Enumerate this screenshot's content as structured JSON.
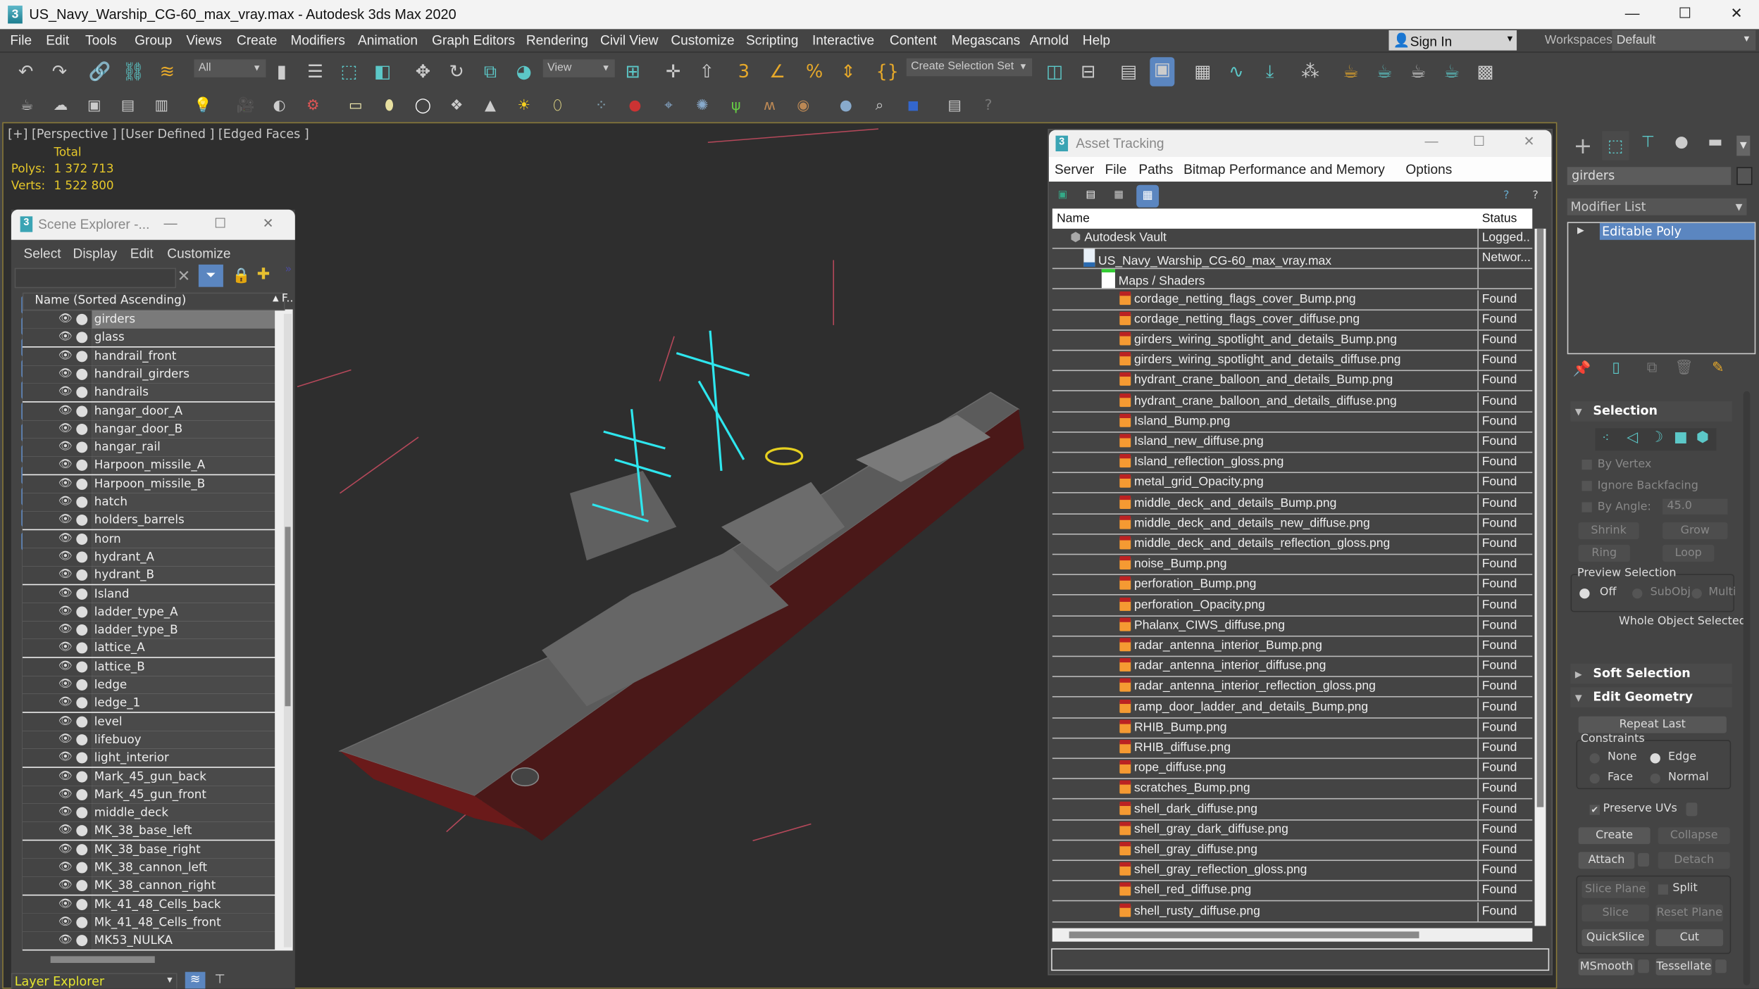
{
  "window": {
    "title": "US_Navy_Warship_CG-60_max_vray.max - Autodesk 3ds Max 2020",
    "app_icon": "3ds-max-logo"
  },
  "menu": [
    "File",
    "Edit",
    "Tools",
    "Group",
    "Views",
    "Create",
    "Modifiers",
    "Animation",
    "Graph Editors",
    "Rendering",
    "Civil View",
    "Customize",
    "Scripting",
    "Interactive",
    "Content",
    "Megascans",
    "Arnold",
    "Help"
  ],
  "account": {
    "sign_in": "Sign In",
    "workspaces_label": "Workspaces:",
    "workspace": "Default"
  },
  "toolbar": {
    "selection_filter": "All",
    "ref_coord": "View",
    "selection_set_placeholder": "Create Selection Set"
  },
  "viewport": {
    "label": "[+] [Perspective ] [User Defined ] [Edged Faces ]",
    "stats_header": "Total",
    "polys_label": "Polys:",
    "polys": "1 372 713",
    "verts_label": "Verts:",
    "verts": "1 522 800",
    "colors": {
      "grid_red": "#b5485a",
      "selection": "#2ee6ee",
      "hull": "#6a6a6a",
      "keel": "#8a1a1a"
    }
  },
  "scene_explorer": {
    "title": "Scene Explorer -...",
    "menu": [
      "Select",
      "Display",
      "Edit",
      "Customize"
    ],
    "column_header": "Name (Sorted Ascending)",
    "column2": "F..",
    "items": [
      "girders",
      "glass",
      "handrail_front",
      "handrail_girders",
      "handrails",
      "hangar_door_A",
      "hangar_door_B",
      "hangar_rail",
      "Harpoon_missile_A",
      "Harpoon_missile_B",
      "hatch",
      "holders_barrels",
      "horn",
      "hydrant_A",
      "hydrant_B",
      "Island",
      "ladder_type_A",
      "ladder_type_B",
      "lattice_A",
      "lattice_B",
      "ledge",
      "ledge_1",
      "level",
      "lifebuoy",
      "light_interior",
      "Mark_45_gun_back",
      "Mark_45_gun_front",
      "middle_deck",
      "MK_38_base_left",
      "MK_38_base_right",
      "MK_38_cannon_left",
      "MK_38_cannon_right",
      "Mk_41_48_Cells_back",
      "Mk_41_48_Cells_front",
      "MK53_NULKA"
    ],
    "selected": "girders",
    "footer_dropdown": "Layer Explorer"
  },
  "asset_tracking": {
    "title": "Asset Tracking",
    "menu": [
      "Server",
      "File",
      "Paths",
      "Bitmap Performance and Memory",
      "Options"
    ],
    "columns": [
      "Name",
      "Status"
    ],
    "rows": [
      {
        "name": "Autodesk Vault",
        "status": "Logged..",
        "level": 0,
        "icon": "vault-icon"
      },
      {
        "name": "US_Navy_Warship_CG-60_max_vray.max",
        "status": "Networ...",
        "level": 1,
        "icon": "max-file-icon"
      },
      {
        "name": "Maps / Shaders",
        "status": "",
        "level": 2,
        "icon": "maps-folder-icon"
      },
      {
        "name": "cordage_netting_flags_cover_Bump.png",
        "status": "Found",
        "level": 3,
        "icon": "png-icon"
      },
      {
        "name": "cordage_netting_flags_cover_diffuse.png",
        "status": "Found",
        "level": 3,
        "icon": "png-icon"
      },
      {
        "name": "girders_wiring_spotlight_and_details_Bump.png",
        "status": "Found",
        "level": 3,
        "icon": "png-icon"
      },
      {
        "name": "girders_wiring_spotlight_and_details_diffuse.png",
        "status": "Found",
        "level": 3,
        "icon": "png-icon"
      },
      {
        "name": "hydrant_crane_balloon_and_details_Bump.png",
        "status": "Found",
        "level": 3,
        "icon": "png-icon"
      },
      {
        "name": "hydrant_crane_balloon_and_details_diffuse.png",
        "status": "Found",
        "level": 3,
        "icon": "png-icon"
      },
      {
        "name": "Island_Bump.png",
        "status": "Found",
        "level": 3,
        "icon": "png-icon"
      },
      {
        "name": "Island_new_diffuse.png",
        "status": "Found",
        "level": 3,
        "icon": "png-icon"
      },
      {
        "name": "Island_reflection_gloss.png",
        "status": "Found",
        "level": 3,
        "icon": "png-icon"
      },
      {
        "name": "metal_grid_Opacity.png",
        "status": "Found",
        "level": 3,
        "icon": "png-icon"
      },
      {
        "name": "middle_deck_and_details_Bump.png",
        "status": "Found",
        "level": 3,
        "icon": "png-icon"
      },
      {
        "name": "middle_deck_and_details_new_diffuse.png",
        "status": "Found",
        "level": 3,
        "icon": "png-icon"
      },
      {
        "name": "middle_deck_and_details_reflection_gloss.png",
        "status": "Found",
        "level": 3,
        "icon": "png-icon"
      },
      {
        "name": "noise_Bump.png",
        "status": "Found",
        "level": 3,
        "icon": "png-icon"
      },
      {
        "name": "perforation_Bump.png",
        "status": "Found",
        "level": 3,
        "icon": "png-icon"
      },
      {
        "name": "perforation_Opacity.png",
        "status": "Found",
        "level": 3,
        "icon": "png-icon"
      },
      {
        "name": "Phalanx_CIWS_diffuse.png",
        "status": "Found",
        "level": 3,
        "icon": "png-icon"
      },
      {
        "name": "radar_antenna_interior_Bump.png",
        "status": "Found",
        "level": 3,
        "icon": "png-icon"
      },
      {
        "name": "radar_antenna_interior_diffuse.png",
        "status": "Found",
        "level": 3,
        "icon": "png-icon"
      },
      {
        "name": "radar_antenna_interior_reflection_gloss.png",
        "status": "Found",
        "level": 3,
        "icon": "png-icon"
      },
      {
        "name": "ramp_door_ladder_and_details_Bump.png",
        "status": "Found",
        "level": 3,
        "icon": "png-icon"
      },
      {
        "name": "RHIB_Bump.png",
        "status": "Found",
        "level": 3,
        "icon": "png-icon"
      },
      {
        "name": "RHIB_diffuse.png",
        "status": "Found",
        "level": 3,
        "icon": "png-icon"
      },
      {
        "name": "rope_diffuse.png",
        "status": "Found",
        "level": 3,
        "icon": "png-icon"
      },
      {
        "name": "scratches_Bump.png",
        "status": "Found",
        "level": 3,
        "icon": "png-icon"
      },
      {
        "name": "shell_dark_diffuse.png",
        "status": "Found",
        "level": 3,
        "icon": "png-icon"
      },
      {
        "name": "shell_gray_dark_diffuse.png",
        "status": "Found",
        "level": 3,
        "icon": "png-icon"
      },
      {
        "name": "shell_gray_diffuse.png",
        "status": "Found",
        "level": 3,
        "icon": "png-icon"
      },
      {
        "name": "shell_gray_reflection_gloss.png",
        "status": "Found",
        "level": 3,
        "icon": "png-icon"
      },
      {
        "name": "shell_red_diffuse.png",
        "status": "Found",
        "level": 3,
        "icon": "png-icon"
      },
      {
        "name": "shell_rusty_diffuse.png",
        "status": "Found",
        "level": 3,
        "icon": "png-icon"
      }
    ]
  },
  "command_panel": {
    "object_name": "girders",
    "modifier_list": "Modifier List",
    "stack": [
      "Editable Poly"
    ],
    "selection": {
      "title": "Selection",
      "by_vertex": "By Vertex",
      "ignore_backfacing": "Ignore Backfacing",
      "by_angle": "By Angle:",
      "angle_value": "45.0",
      "shrink": "Shrink",
      "grow": "Grow",
      "ring": "Ring",
      "loop": "Loop",
      "preview_title": "Preview Selection",
      "preview_options": [
        "Off",
        "SubObj",
        "Multi"
      ],
      "preview_selected": "Off",
      "status": "Whole Object Selected"
    },
    "soft_selection": {
      "title": "Soft Selection"
    },
    "edit_geometry": {
      "title": "Edit Geometry",
      "repeat_last": "Repeat Last",
      "constraints_title": "Constraints",
      "constraints": [
        "None",
        "Edge",
        "Face",
        "Normal"
      ],
      "constraint_selected": "Edge",
      "preserve_uvs": "Preserve UVs",
      "preserve_uvs_checked": true,
      "create": "Create",
      "collapse": "Collapse",
      "attach": "Attach",
      "detach": "Detach",
      "slice_plane": "Slice Plane",
      "split": "Split",
      "slice": "Slice",
      "reset_plane": "Reset Plane",
      "quickslice": "QuickSlice",
      "cut": "Cut",
      "msmooth": "MSmooth",
      "tessellate": "Tessellate"
    }
  }
}
